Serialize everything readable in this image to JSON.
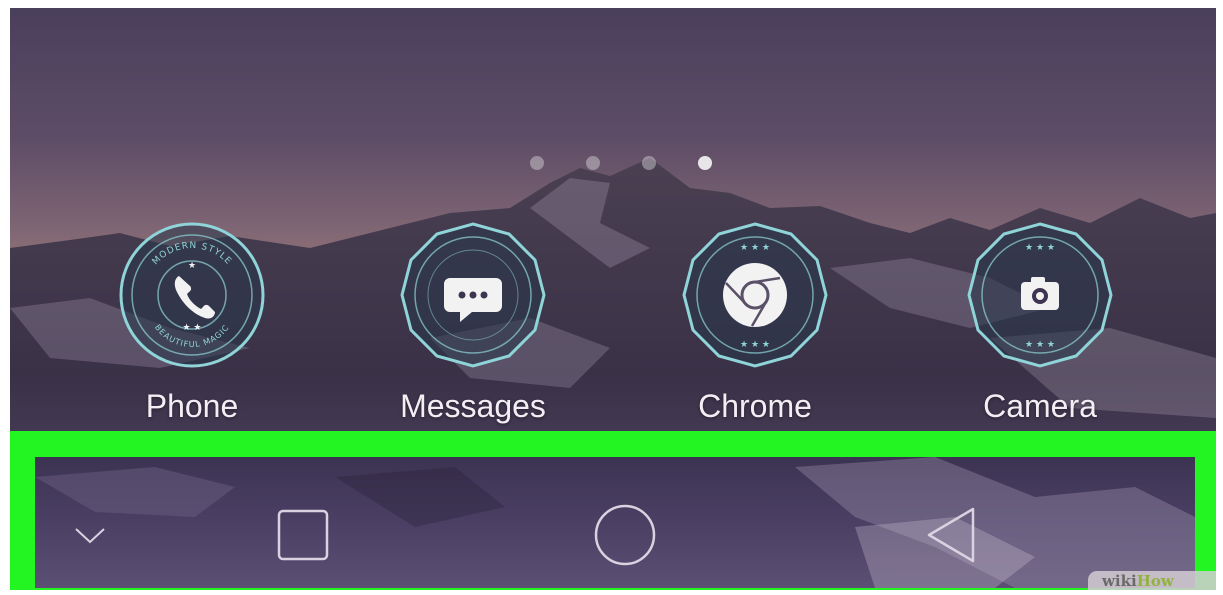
{
  "home_screen": {
    "page_indicator": {
      "count": 4,
      "active_index": 3
    },
    "apps": [
      {
        "label": "Phone",
        "icon": "phone-icon"
      },
      {
        "label": "Messages",
        "icon": "message-bubble-icon"
      },
      {
        "label": "Chrome",
        "icon": "chrome-icon"
      },
      {
        "label": "Camera",
        "icon": "camera-icon"
      }
    ],
    "phone_badge": {
      "top_text": "MODERN STYLE",
      "bottom_text": "BEAUTIFUL MAGIC"
    }
  },
  "nav_bar": {
    "highlight_color": "#22f522",
    "buttons": [
      {
        "icon": "chevron-down-icon"
      },
      {
        "icon": "recent-apps-icon"
      },
      {
        "icon": "home-circle-icon"
      },
      {
        "icon": "back-triangle-icon"
      }
    ]
  },
  "watermark": {
    "prefix": "wiki",
    "suffix": "How"
  }
}
